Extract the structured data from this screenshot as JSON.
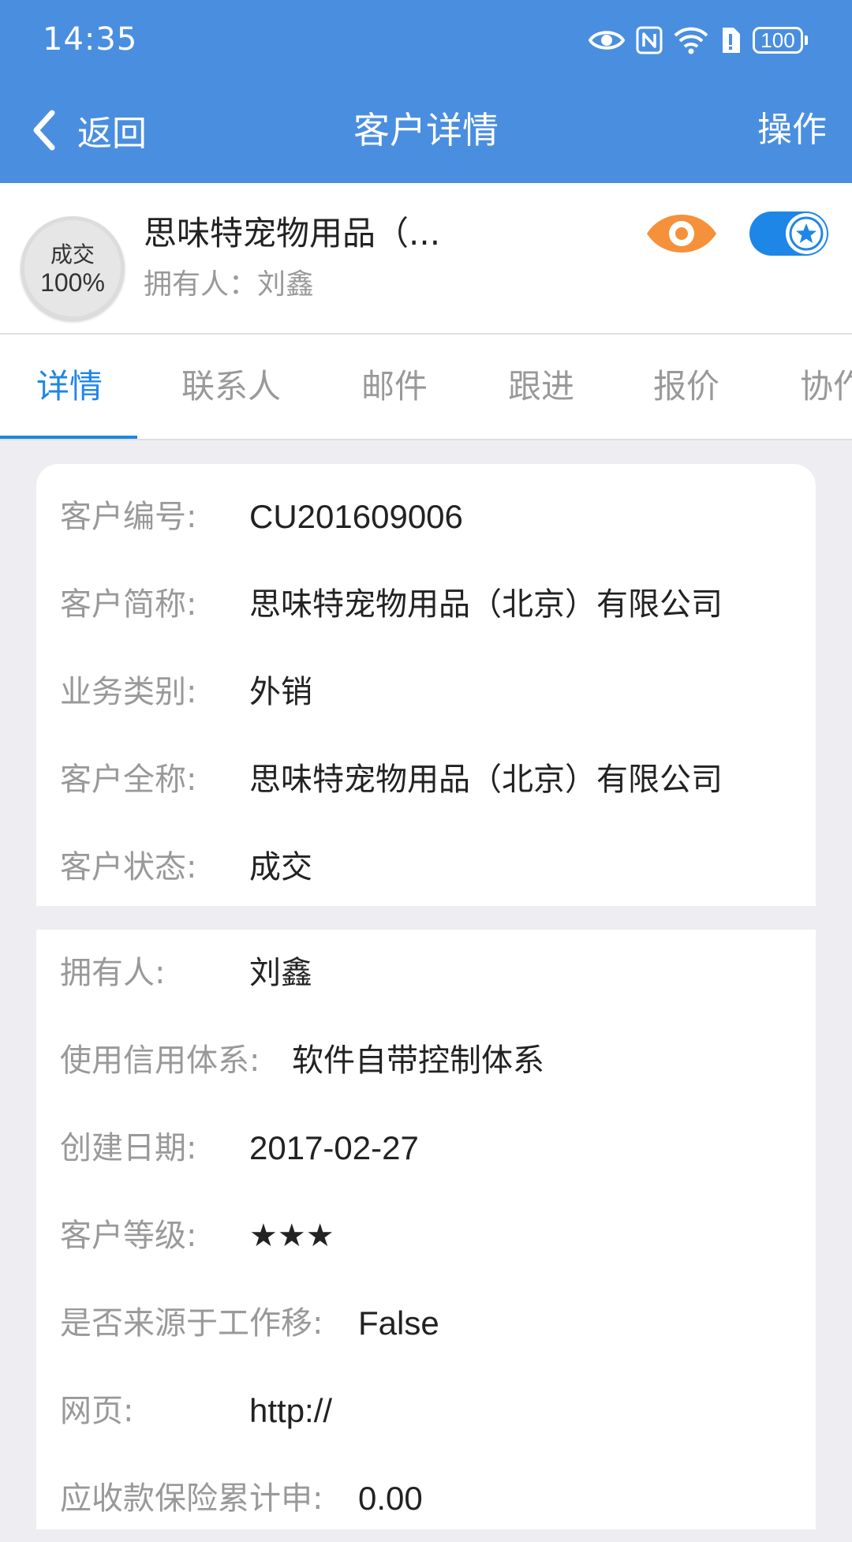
{
  "status_bar": {
    "time": "14:35",
    "battery": "100"
  },
  "nav": {
    "back_label": "返回",
    "title": "客户详情",
    "action_label": "操作"
  },
  "customer": {
    "stage_label": "成交",
    "stage_progress": "100%",
    "name": "思味特宠物用品（...",
    "owner_line": "拥有人：刘鑫"
  },
  "tabs": [
    {
      "label": "详情",
      "active": true
    },
    {
      "label": "联系人",
      "active": false
    },
    {
      "label": "邮件",
      "active": false
    },
    {
      "label": "跟进",
      "active": false
    },
    {
      "label": "报价",
      "active": false
    },
    {
      "label": "协作",
      "active": false
    }
  ],
  "details_primary": [
    {
      "label": "客户编号:",
      "value": "CU201609006"
    },
    {
      "label": "客户简称:",
      "value": "思味特宠物用品（北京）有限公司"
    },
    {
      "label": "业务类别:",
      "value": "外销"
    },
    {
      "label": "客户全称:",
      "value": "思味特宠物用品（北京）有限公司"
    },
    {
      "label": "客户状态:",
      "value": "成交"
    }
  ],
  "details_secondary": [
    {
      "label": "拥有人:",
      "value": "刘鑫"
    },
    {
      "label": "使用信用体系:",
      "value": "软件自带控制体系"
    },
    {
      "label": "创建日期:",
      "value": "2017-02-27"
    },
    {
      "label": "客户等级:",
      "value": "★★★"
    },
    {
      "label": "是否来源于工作移:",
      "value": "False"
    },
    {
      "label": "网页:",
      "value": "http://"
    },
    {
      "label": "应收款保险累计申:",
      "value": "0.00"
    }
  ],
  "colors": {
    "header": "#4a8ee0",
    "accent": "#1e86e6",
    "watch_icon": "#f5913a"
  },
  "icons": {
    "back": "chevron-left-icon",
    "watch": "eye-icon",
    "favorite": "star-icon"
  }
}
